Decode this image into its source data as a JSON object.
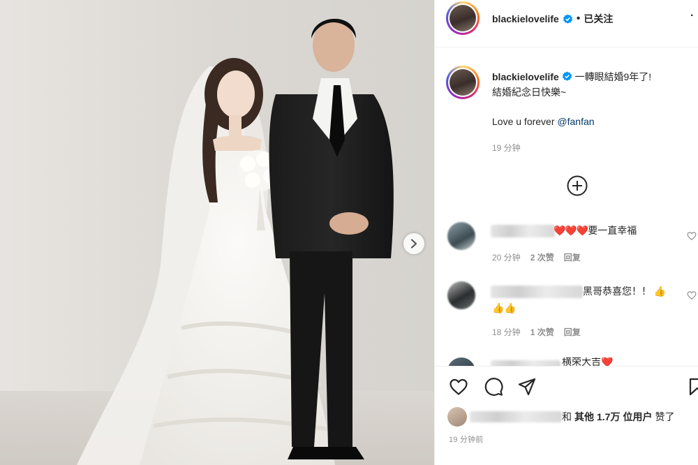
{
  "header": {
    "username": "blackielovelife",
    "separator": "•",
    "follow_label": "已关注",
    "more_label": "·"
  },
  "caption": {
    "username": "blackielovelife",
    "text_line1": "一轉眼結婚9年了!",
    "text_line2": "結婚紀念日快樂~",
    "love_text": "Love u forever ",
    "mention": "@fanfan",
    "time": "19 分钟"
  },
  "comments": [
    {
      "text": "要一直幸福",
      "emoji": "❤️❤️❤️",
      "time": "20 分钟",
      "likes": "2 次赞",
      "reply": "回复"
    },
    {
      "text_line1": "黑哥恭喜您！！",
      "emoji_line1": "👍",
      "emoji_line2": "👍👍",
      "time": "18 分钟",
      "likes": "1 次赞",
      "reply": "回复"
    },
    {
      "text": "横荣大吉",
      "emoji": "❤️"
    }
  ],
  "likes_row": {
    "name_tail": "和",
    "others_label": "其他",
    "count": "1.7万",
    "users_label": "位用户",
    "suffix": "赞了"
  },
  "post_time": "19 分钟前",
  "icons": {
    "next": "chevron-right-icon",
    "load_more": "plus-circle-icon",
    "like": "heart-icon",
    "comment": "comment-icon",
    "share": "paper-plane-icon",
    "save": "bookmark-icon",
    "verified": "verified-badge-icon"
  },
  "colors": {
    "verified": "#0095f6",
    "mention": "#00376b",
    "secondary_text": "#8e8e8e",
    "heart_red": "#ed4956"
  }
}
